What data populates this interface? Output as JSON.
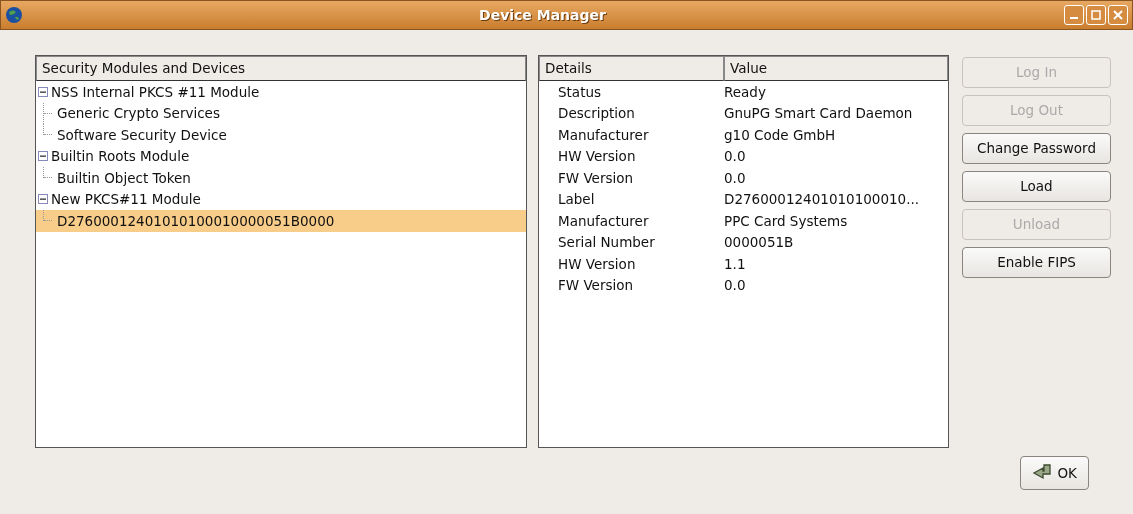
{
  "window": {
    "title": "Device Manager"
  },
  "tree": {
    "column": "Security Modules and Devices",
    "items": [
      {
        "label": "NSS Internal PKCS #11 Module",
        "expanded": true,
        "selected": false,
        "children": [
          {
            "label": "Generic Crypto Services",
            "selected": false
          },
          {
            "label": "Software Security Device",
            "selected": false
          }
        ]
      },
      {
        "label": "Builtin Roots Module",
        "expanded": true,
        "selected": false,
        "children": [
          {
            "label": "Builtin Object Token",
            "selected": false
          }
        ]
      },
      {
        "label": "New PKCS#11 Module",
        "expanded": true,
        "selected": false,
        "children": [
          {
            "label": "D27600012401010100010000051B0000",
            "selected": true
          }
        ]
      }
    ]
  },
  "details": {
    "columns": [
      "Details",
      "Value"
    ],
    "rows": [
      {
        "name": "Status",
        "value": "Ready"
      },
      {
        "name": "Description",
        "value": "GnuPG Smart Card Daemon"
      },
      {
        "name": "Manufacturer",
        "value": "g10 Code GmbH"
      },
      {
        "name": "HW Version",
        "value": "0.0"
      },
      {
        "name": "FW Version",
        "value": "0.0"
      },
      {
        "name": "Label",
        "value": "D27600012401010100010..."
      },
      {
        "name": "Manufacturer",
        "value": "PPC Card Systems"
      },
      {
        "name": "Serial Number",
        "value": "0000051B"
      },
      {
        "name": "HW Version",
        "value": "1.1"
      },
      {
        "name": "FW Version",
        "value": "0.0"
      }
    ]
  },
  "buttons": [
    {
      "label": "Log In",
      "disabled": true
    },
    {
      "label": "Log Out",
      "disabled": true
    },
    {
      "label": "Change Password",
      "disabled": false
    },
    {
      "label": "Load",
      "disabled": false
    },
    {
      "label": "Unload",
      "disabled": true
    },
    {
      "label": "Enable FIPS",
      "disabled": false
    }
  ],
  "ok_button": {
    "label": "OK"
  }
}
